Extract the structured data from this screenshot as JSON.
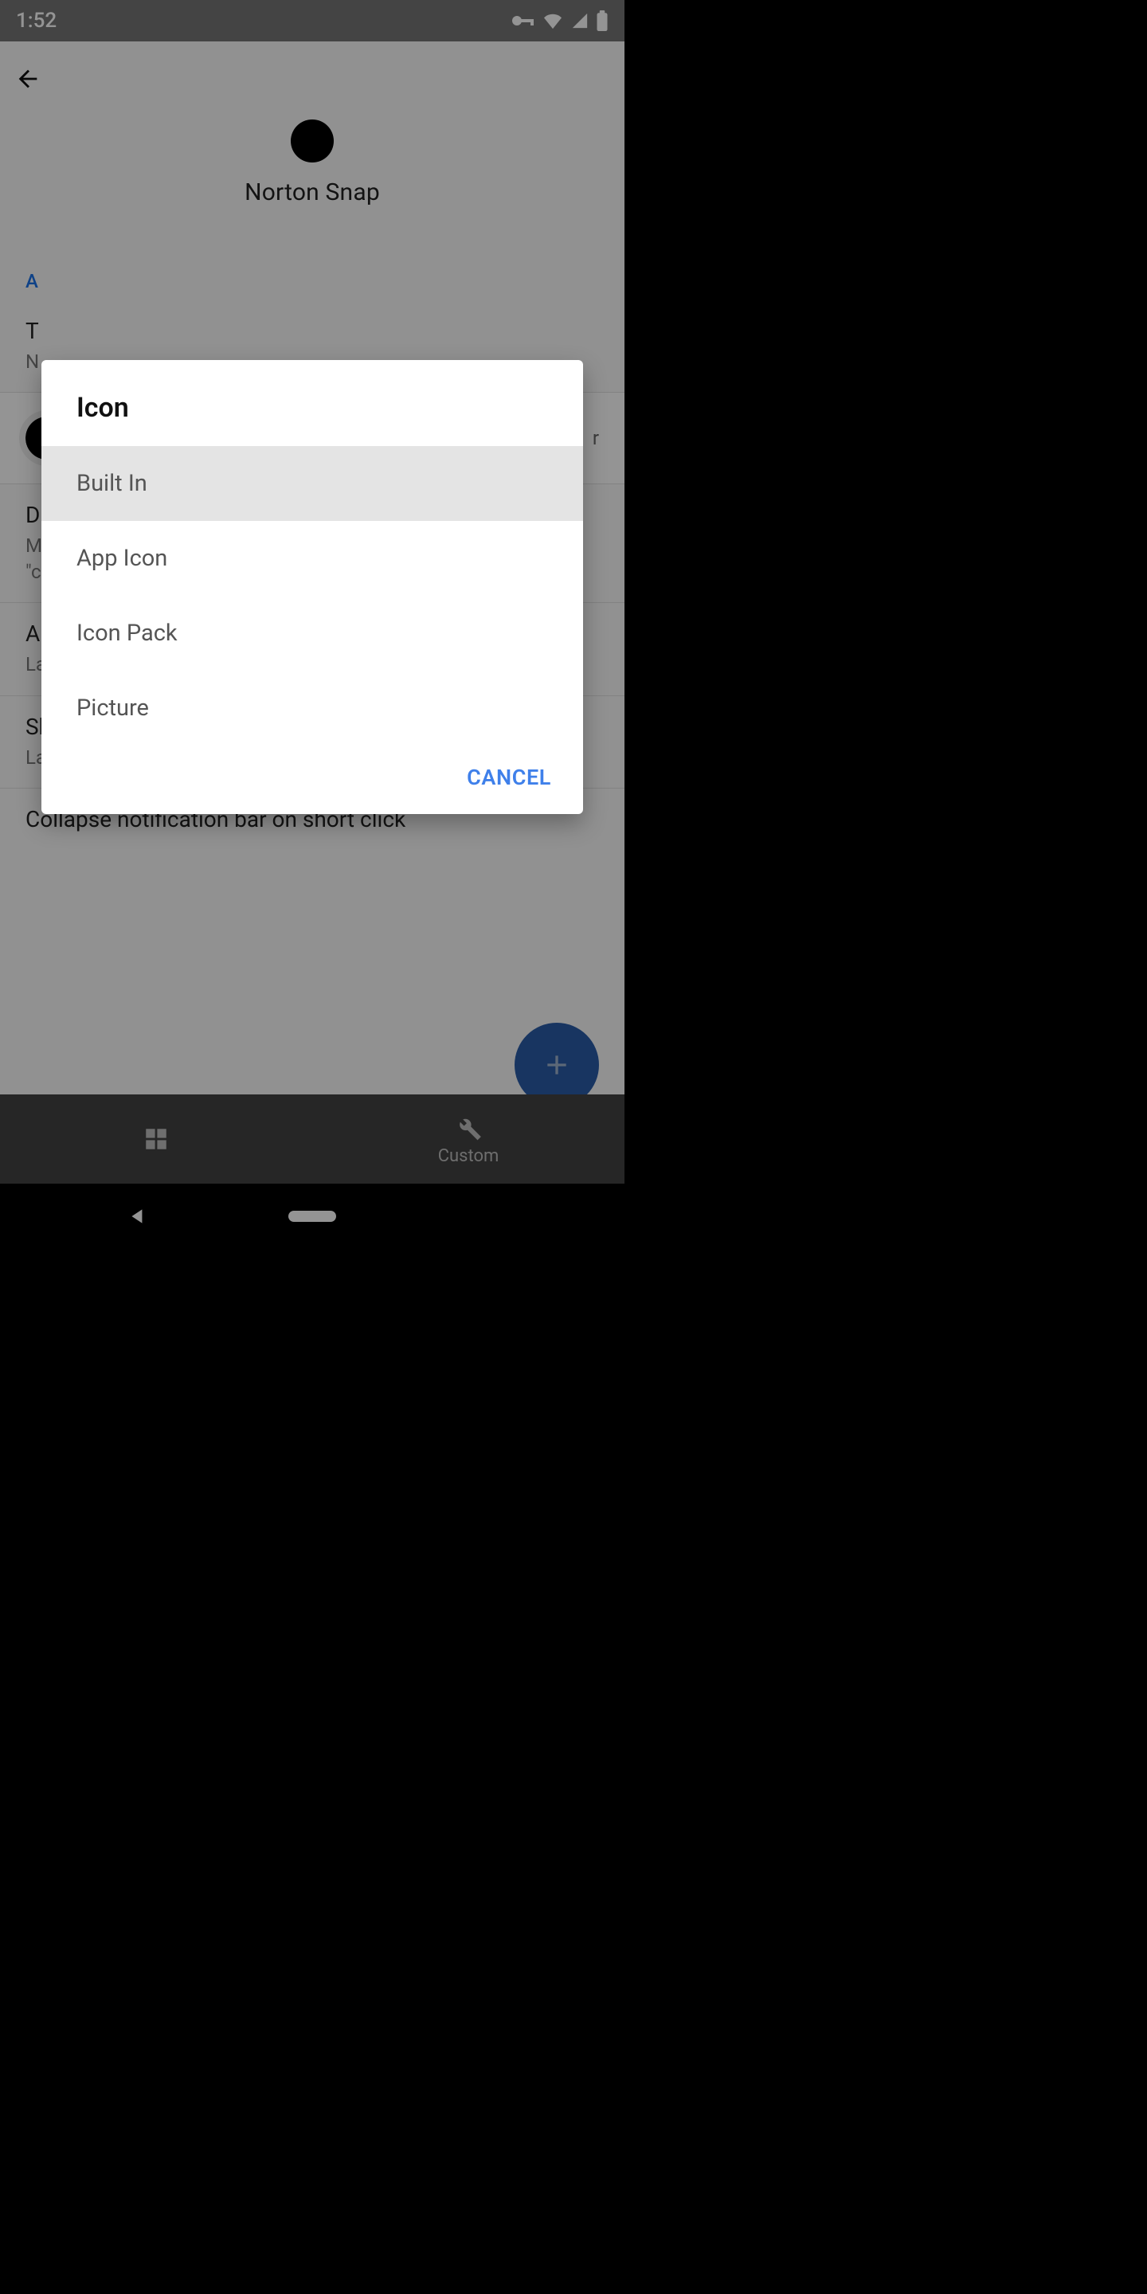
{
  "status": {
    "time": "1:52"
  },
  "header": {
    "app_name": "Norton Snap"
  },
  "section": {
    "label": "A"
  },
  "items": {
    "title_row": {
      "title": "T",
      "subtitle": "N"
    },
    "icon_row": {
      "picker_hint": "r"
    },
    "d_row": {
      "title": "D",
      "subtitle_line1": "M",
      "subtitle_line2": "\"c"
    },
    "a_row": {
      "title": "A",
      "subtitle": "Last action is clicked"
    },
    "short_click": {
      "title": "Short Click Action",
      "subtitle": "Launch Norton Snap"
    },
    "collapse": {
      "title": "Collapse notification bar on short click"
    }
  },
  "tabs": {
    "custom": "Custom"
  },
  "dialog": {
    "title": "Icon",
    "options": [
      "Built In",
      "App Icon",
      "Icon Pack",
      "Picture"
    ],
    "selected_index": 0,
    "cancel": "CANCEL"
  }
}
